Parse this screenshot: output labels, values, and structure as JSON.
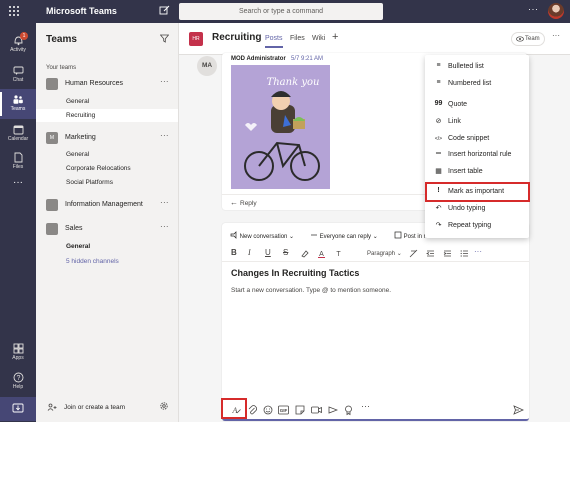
{
  "topbar": {
    "app_title": "Microsoft Teams",
    "search_placeholder": "Search or type a command",
    "more_glyph": "···"
  },
  "rail": {
    "items": [
      {
        "label": "Activity",
        "icon": "bell-icon",
        "badge": "1"
      },
      {
        "label": "Chat",
        "icon": "chat-icon"
      },
      {
        "label": "Teams",
        "icon": "teams-icon",
        "active": true
      },
      {
        "label": "Calendar",
        "icon": "calendar-icon"
      },
      {
        "label": "Files",
        "icon": "files-icon"
      },
      {
        "label": "Apps",
        "icon": "apps-icon"
      },
      {
        "label": "Help",
        "icon": "help-icon"
      }
    ],
    "more_glyph": "···"
  },
  "teams_panel": {
    "title": "Teams",
    "section_label": "Your teams",
    "teams": [
      {
        "tile": "",
        "name": "Human Resources",
        "channels": [
          "General",
          "Recruiting"
        ],
        "selected_channel": "Recruiting"
      },
      {
        "tile": "M",
        "name": "Marketing",
        "channels": [
          "General",
          "Corporate Relocations",
          "Social Platforms"
        ]
      },
      {
        "tile": "",
        "name": "Information Management",
        "channels": []
      },
      {
        "tile": "",
        "name": "Sales",
        "channels": [
          "General",
          "5 hidden channels"
        ]
      }
    ],
    "dots": "···",
    "join_label": "Join or create a team"
  },
  "channel_header": {
    "tile": "HR",
    "name": "Recruiting",
    "tabs": [
      "Posts",
      "Files",
      "Wiki"
    ],
    "active_tab": "Posts",
    "add_tab": "+",
    "team_button": "Team",
    "dots": "···"
  },
  "message": {
    "avatar_initials": "MA",
    "author": "MOD Administrator",
    "time": "5/7 9:21 AM",
    "sticker_text": "Thank you",
    "reply_label": "Reply"
  },
  "compose": {
    "options": [
      "New conversation",
      "Everyone can reply",
      "Post in mul"
    ],
    "format_buttons": [
      "B",
      "I",
      "U",
      "S"
    ],
    "paragraph_label": "Paragraph",
    "more_glyph": "···",
    "subject": "Changes In Recruiting Tactics",
    "placeholder": "Start a new conversation. Type @ to mention someone."
  },
  "menu": {
    "items": [
      {
        "label": "Bulleted list",
        "icon": "bulleted-list-icon"
      },
      {
        "label": "Numbered list",
        "icon": "numbered-list-icon"
      },
      {
        "label": "Quote",
        "icon": "quote-icon"
      },
      {
        "label": "Link",
        "icon": "link-icon"
      },
      {
        "label": "Code snippet",
        "icon": "code-snippet-icon"
      },
      {
        "label": "Insert horizontal rule",
        "icon": "horizontal-rule-icon"
      },
      {
        "label": "Insert table",
        "icon": "table-icon"
      },
      {
        "label": "Mark as important",
        "icon": "exclamation-icon",
        "highlighted": true
      },
      {
        "label": "Undo typing",
        "icon": "undo-icon"
      },
      {
        "label": "Repeat typing",
        "icon": "redo-icon"
      }
    ],
    "glyphs": [
      "≡",
      "≡",
      "99",
      "⊘",
      "</>",
      "═",
      "▦",
      "!",
      "↶",
      "↷"
    ]
  },
  "toolbar": {
    "items": [
      "format-icon",
      "attach-icon",
      "emoji-icon",
      "gif-icon",
      "sticker-icon",
      "meet-now-icon",
      "stream-icon",
      "praise-icon",
      "more-icon",
      "send-icon"
    ],
    "gif_text": "GIF",
    "more_glyph": "···"
  },
  "colors": {
    "header_bg": "#33344a",
    "accent": "#6264a7",
    "highlight": "#d62b2b",
    "channel_tile": "#c4314b"
  }
}
